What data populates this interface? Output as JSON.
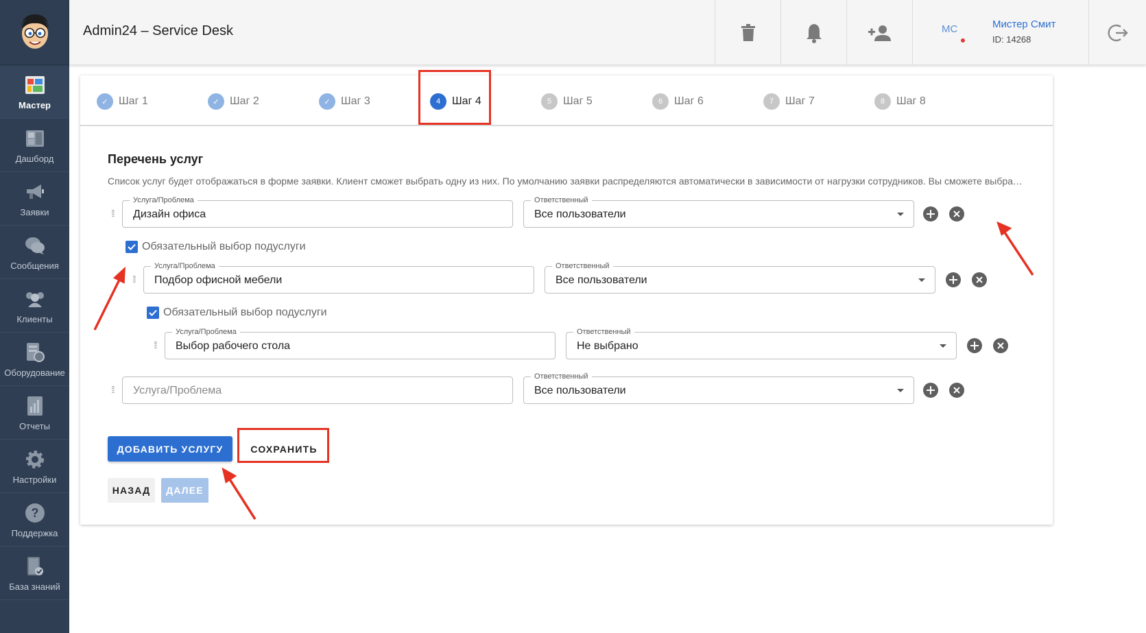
{
  "app": {
    "title": "Admin24 – Service Desk"
  },
  "sidebar": {
    "items": [
      {
        "label": "Мастер",
        "icon": "wizard-icon",
        "active": true
      },
      {
        "label": "Дашборд",
        "icon": "dashboard-icon"
      },
      {
        "label": "Заявки",
        "icon": "megaphone-icon"
      },
      {
        "label": "Сообщения",
        "icon": "chat-icon"
      },
      {
        "label": "Клиенты",
        "icon": "clients-icon"
      },
      {
        "label": "Оборудование",
        "icon": "equipment-icon"
      },
      {
        "label": "Отчеты",
        "icon": "report-icon"
      },
      {
        "label": "Настройки",
        "icon": "gear-icon"
      },
      {
        "label": "Поддержка",
        "icon": "help-icon"
      },
      {
        "label": "База знаний",
        "icon": "knowledge-base-icon"
      }
    ]
  },
  "header": {
    "icons": [
      "trash-icon",
      "bell-icon",
      "add-user-icon",
      "logout-icon"
    ],
    "user": {
      "initials": "МС",
      "name": "Мистер Смит",
      "id_text": "ID: 14268"
    }
  },
  "steps": [
    {
      "label": "Шаг 1",
      "num": "✓",
      "state": "done"
    },
    {
      "label": "Шаг 2",
      "num": "✓",
      "state": "done"
    },
    {
      "label": "Шаг 3",
      "num": "✓",
      "state": "done"
    },
    {
      "label": "Шаг 4",
      "num": "4",
      "state": "current"
    },
    {
      "label": "Шаг 5",
      "num": "5",
      "state": "todo"
    },
    {
      "label": "Шаг 6",
      "num": "6",
      "state": "todo"
    },
    {
      "label": "Шаг 7",
      "num": "7",
      "state": "todo"
    },
    {
      "label": "Шаг 8",
      "num": "8",
      "state": "todo"
    }
  ],
  "content": {
    "title": "Перечень услуг",
    "description": "Список услуг будет отображаться в форме заявки. Клиент сможет выбрать одну из них. По умолчанию заявки распределяются автоматически в зависимости от нагрузки сотрудников. Вы сможете выбрать ответственного за конкретную услугу.",
    "service_label": "Услуга/Проблема",
    "responsible_label": "Ответственный",
    "rows": [
      {
        "service": "Дизайн офиса",
        "responsible": "Все пользователи"
      },
      {
        "service": "Подбор офисной мебели",
        "responsible": "Все пользователи"
      },
      {
        "service": "Выбор рабочего стола",
        "responsible": "Не выбрано"
      },
      {
        "service": "",
        "service_placeholder": "Услуга/Проблема",
        "responsible": "Все пользователи"
      }
    ],
    "checkbox_label": "Обязательный выбор подуслуги",
    "checkbox_1_checked": true,
    "checkbox_2_checked": true
  },
  "buttons": {
    "add_service": "ДОБАВИТЬ УСЛУГУ",
    "save": "СОХРАНИТЬ",
    "back": "НАЗАД",
    "next": "ДАЛЕЕ"
  },
  "colors": {
    "accent": "#2d6fd1",
    "sidebar": "#2f3e52",
    "highlight": "#e53223"
  }
}
